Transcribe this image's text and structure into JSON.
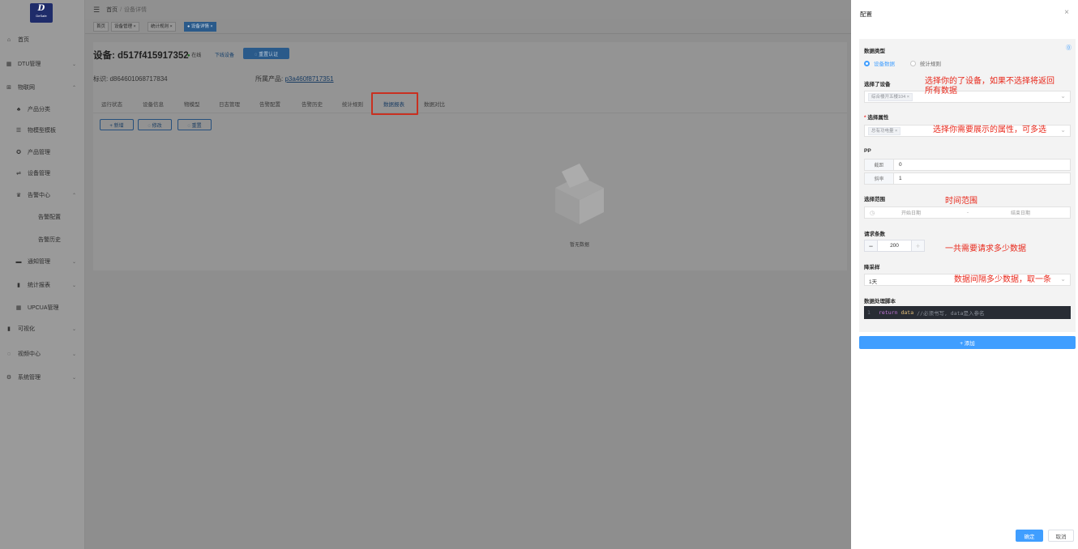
{
  "brand": {
    "logo_letter": "D",
    "logo_sub": "DeSafe"
  },
  "sidebar": {
    "items": [
      {
        "label": "首页",
        "icon": "home-icon",
        "glyph": "⌂"
      },
      {
        "label": "DTU管理",
        "icon": "dtu-icon",
        "glyph": "▦",
        "arrow": "⌄"
      },
      {
        "label": "物联网",
        "icon": "iot-icon",
        "glyph": "⊞",
        "arrow": "⌃"
      },
      {
        "label": "产品分类",
        "icon": "category-icon",
        "glyph": "♣"
      },
      {
        "label": "物模型模板",
        "icon": "list-icon",
        "glyph": "☰"
      },
      {
        "label": "产品管理",
        "icon": "product-icon",
        "glyph": "✪"
      },
      {
        "label": "设备管理",
        "icon": "device-icon",
        "glyph": "⇌"
      },
      {
        "label": "告警中心",
        "icon": "alarm-icon",
        "glyph": "♛",
        "arrow": "⌃"
      },
      {
        "label": "告警配置",
        "icon": "",
        "glyph": ""
      },
      {
        "label": "告警历史",
        "icon": "",
        "glyph": ""
      },
      {
        "label": "通知管理",
        "icon": "notify-icon",
        "glyph": "▬",
        "arrow": "⌄"
      },
      {
        "label": "统计报表",
        "icon": "report-icon",
        "glyph": "▮",
        "arrow": "⌄"
      },
      {
        "label": "UPCUA管理",
        "icon": "upcua-icon",
        "glyph": "▦"
      },
      {
        "label": "可视化",
        "icon": "visual-icon",
        "glyph": "▮",
        "arrow": "⌄"
      },
      {
        "label": "视频中心",
        "icon": "video-icon",
        "glyph": "◌",
        "arrow": "⌄"
      },
      {
        "label": "系统管理",
        "icon": "settings-icon",
        "glyph": "⚙",
        "arrow": "⌄"
      }
    ]
  },
  "topbar": {
    "crumb_home": "首页",
    "crumb_sep": "/",
    "crumb_current": "设备详情"
  },
  "tabs": [
    {
      "label": "首页"
    },
    {
      "label": "设备管理 ×"
    },
    {
      "label": "统计规则 ×"
    },
    {
      "label": "● 设备详情 ×"
    }
  ],
  "device": {
    "title": "设备: d517f415917352",
    "status_dot": "●",
    "status": "在线",
    "offline_link": "下线设备",
    "auth_button": "◌ 重置认证",
    "id_label": "标识: d864601068717834",
    "product_label": "所属产品:",
    "product_link": "p3a460f8717351"
  },
  "subtabs": [
    "运行状态",
    "设备信息",
    "物模型",
    "日志管理",
    "告警配置",
    "告警历史",
    "统计规则",
    "数据报表",
    "数据对比"
  ],
  "actions": {
    "add": "+ 新增",
    "edit": "◌ 修改",
    "reset": "◌ 重置"
  },
  "empty": {
    "text": "暂无数据"
  },
  "drawer": {
    "title": "配置",
    "close": "×",
    "help_icon": "⓪",
    "data_type_label": "数据类型",
    "radio_device": "设备数据",
    "radio_rule": "统计规则",
    "device_label": "选择了设备",
    "device_chip": "综合楼开五楼104 ×",
    "attr_required": "*",
    "attr_label": "选择属性",
    "attr_chip": "总有功电量 ×",
    "pp_label": "PP",
    "pp_rows": [
      {
        "k": "截距",
        "v": "0"
      },
      {
        "k": "斜率",
        "v": "1"
      }
    ],
    "range_label": "选择范围",
    "range_icon": "◷",
    "start_placeholder": "开始日期",
    "range_sep": "-",
    "end_placeholder": "结束日期",
    "count_label": "请求条数",
    "count_minus": "−",
    "count_value": "200",
    "count_plus": "+",
    "sample_label": "降采样",
    "sample_value": "1天",
    "caret": "⌄",
    "script_label": "数据处理脚本",
    "code_line": "1",
    "code_kw": "return",
    "code_var": "data",
    "code_comment": "//必须书写, data是入参名",
    "add_button": "+ 添加",
    "ok_button": "确定",
    "cancel_button": "取消"
  },
  "annotations": {
    "device": "选择你的了设备，如果不选择将返回\n所有数据",
    "attr": "选择你需要展示的属性，可多选",
    "range": "时间范围",
    "count": "一共需要请求多少数据",
    "sample": "数据间隔多少数据，取一条"
  },
  "colors": {
    "accent": "#409eff",
    "annotation": "#e8281b",
    "highlight_box": "#c93020",
    "code_bg": "#282c34"
  }
}
